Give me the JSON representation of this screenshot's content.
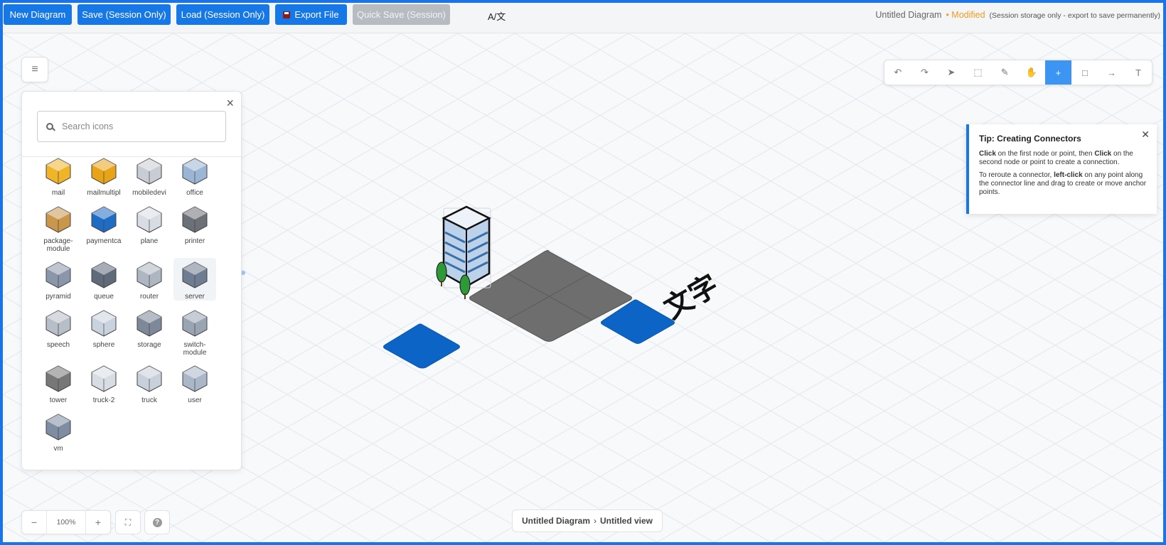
{
  "toolbar": {
    "new_diagram": "New Diagram",
    "save_session": "Save (Session Only)",
    "load_session": "Load (Session Only)",
    "export_file": "Export File",
    "quick_save": "Quick Save (Session)",
    "lang_toggle": "A/文"
  },
  "document": {
    "title": "Untitled Diagram",
    "modified": "• Modified",
    "storage_note": "(Session storage only - export to save permanently)"
  },
  "panel": {
    "search_placeholder": "Search icons",
    "icons": [
      {
        "label": "mail",
        "icon": "mail-icon"
      },
      {
        "label": "mailmultipl",
        "icon": "mail-multiple-icon"
      },
      {
        "label": "mobiledevi",
        "icon": "mobile-device-icon"
      },
      {
        "label": "office",
        "icon": "office-building-icon"
      },
      {
        "label": "package-module",
        "icon": "package-icon"
      },
      {
        "label": "paymentca",
        "icon": "payment-card-icon"
      },
      {
        "label": "plane",
        "icon": "plane-icon"
      },
      {
        "label": "printer",
        "icon": "printer-icon"
      },
      {
        "label": "pyramid",
        "icon": "pyramid-icon"
      },
      {
        "label": "queue",
        "icon": "queue-icon"
      },
      {
        "label": "router",
        "icon": "router-icon"
      },
      {
        "label": "server",
        "icon": "server-icon"
      },
      {
        "label": "speech",
        "icon": "speech-bubble-icon"
      },
      {
        "label": "sphere",
        "icon": "sphere-icon"
      },
      {
        "label": "storage",
        "icon": "storage-icon"
      },
      {
        "label": "switch-module",
        "icon": "switch-icon"
      },
      {
        "label": "tower",
        "icon": "tower-icon"
      },
      {
        "label": "truck-2",
        "icon": "truck-2-icon"
      },
      {
        "label": "truck",
        "icon": "truck-icon"
      },
      {
        "label": "user",
        "icon": "user-icon"
      },
      {
        "label": "vm",
        "icon": "vm-icon"
      }
    ],
    "selected_icon": "server"
  },
  "tools": [
    {
      "name": "undo",
      "glyph": "↶"
    },
    {
      "name": "redo",
      "glyph": "↷"
    },
    {
      "name": "select",
      "glyph": "➤"
    },
    {
      "name": "lasso",
      "glyph": "⬚"
    },
    {
      "name": "freehand-lasso",
      "glyph": "✎"
    },
    {
      "name": "pan",
      "glyph": "✋"
    },
    {
      "name": "add",
      "glyph": "+"
    },
    {
      "name": "rectangle",
      "glyph": "□"
    },
    {
      "name": "connector",
      "glyph": "→"
    },
    {
      "name": "text",
      "glyph": "T"
    }
  ],
  "active_tool": "add",
  "tip": {
    "title": "Tip: Creating Connectors",
    "p1_a": "Click",
    "p1_b": " on the first node or point, then ",
    "p1_c": "Click",
    "p1_d": " on the second node or point to create a connection.",
    "p2_a": "To reroute a connector, ",
    "p2_b": "left-click",
    "p2_c": " on any point along the connector line and drag to create or move anchor points."
  },
  "canvas": {
    "text_label": "文字"
  },
  "zoom": {
    "level": "100%"
  },
  "breadcrumb": {
    "diagram": "Untitled Diagram",
    "view": "Untitled view"
  },
  "colors": {
    "accent": "#1677e6",
    "modified": "#f19c20",
    "tile_blue": "#0c64c6",
    "tile_gray": "#6b6b6b"
  }
}
